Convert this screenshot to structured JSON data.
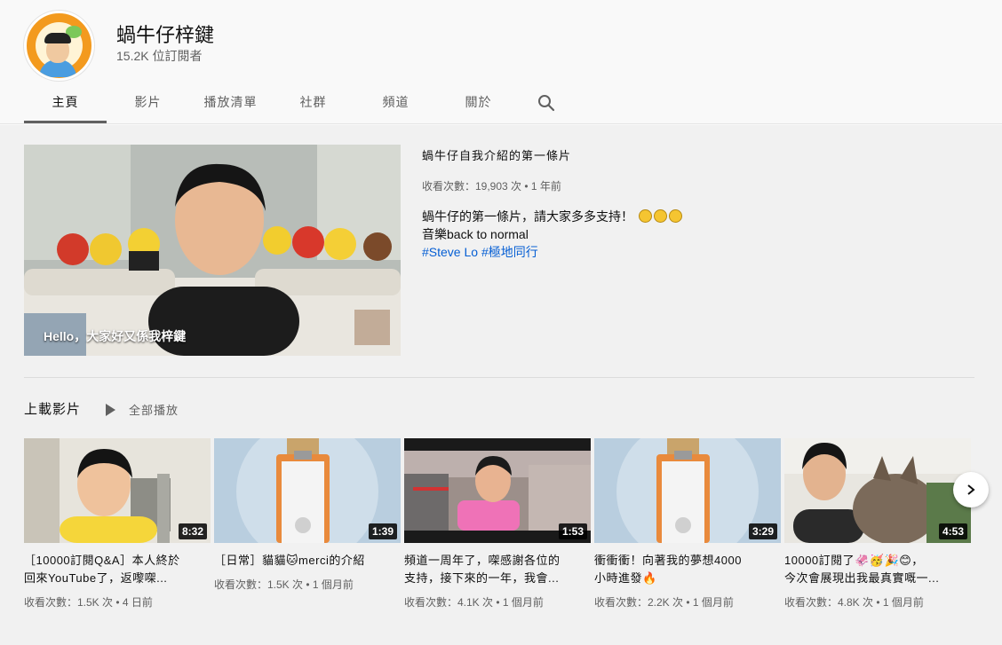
{
  "channel": {
    "name": "蝸牛仔梓鍵",
    "subscribers": "15.2K 位訂閱者"
  },
  "tabs": [
    {
      "label": "主頁",
      "active": true
    },
    {
      "label": "影片",
      "active": false
    },
    {
      "label": "播放清單",
      "active": false
    },
    {
      "label": "社群",
      "active": false
    },
    {
      "label": "頻道",
      "active": false
    },
    {
      "label": "關於",
      "active": false
    }
  ],
  "featured": {
    "title": "蝸牛仔自我介紹的第一條片",
    "meta": "收看次數：19,903 次 • 1 年前",
    "description_line1": "蝸牛仔的第一條片，請大家多多支持！",
    "description_line2": "音樂back to normal",
    "hashtags": [
      "#Steve Lo",
      "#極地同行"
    ],
    "caption": "Hello，大家好又係我梓鍵"
  },
  "shelf": {
    "title": "上載影片",
    "play_all": "全部播放"
  },
  "videos": [
    {
      "duration": "8:32",
      "title_line1": "［10000訂閱Q&A］本人終於",
      "title_line2": "回來YouTube了，返嚟㗎...",
      "meta": "收看次數：1.5K 次 • 4 日前"
    },
    {
      "duration": "1:39",
      "title_line1": "［日常］貓貓🐱merci的介紹",
      "title_line2": "",
      "meta": "收看次數：1.5K 次 • 1 個月前"
    },
    {
      "duration": "1:53",
      "title_line1": "頻道一周年了，㗎感謝各位的",
      "title_line2": "支持，接下來的一年，我會...",
      "meta": "收看次數：4.1K 次 • 1 個月前"
    },
    {
      "duration": "3:29",
      "title_line1": "衝衝衝！向著我的夢想4000",
      "title_line2": "小時進發🔥",
      "meta": "收看次數：2.2K 次 • 1 個月前"
    },
    {
      "duration": "4:53",
      "title_line1": "10000訂閱了🦑🥳🎉😊，",
      "title_line2": "今次會展現出我最真實嘅一...",
      "meta": "收看次數：4.8K 次 • 1 個月前"
    }
  ],
  "colors": {
    "hashtag": "#065fd4",
    "avatar_ring": "#f39a1e"
  }
}
